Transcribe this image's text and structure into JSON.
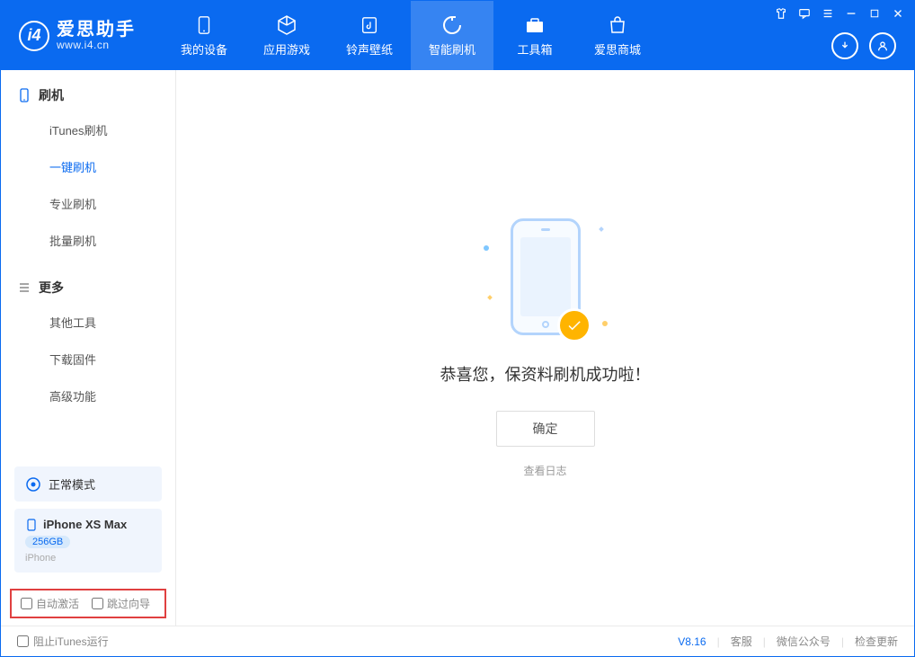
{
  "app": {
    "title": "爱思助手",
    "subtitle": "www.i4.cn"
  },
  "nav": {
    "my_device": "我的设备",
    "apps_games": "应用游戏",
    "ring_wall": "铃声壁纸",
    "smart_flash": "智能刷机",
    "toolbox": "工具箱",
    "store": "爱思商城"
  },
  "sidebar": {
    "section_flash": "刷机",
    "section_more": "更多",
    "items": {
      "itunes_flash": "iTunes刷机",
      "oneclick_flash": "一键刷机",
      "pro_flash": "专业刷机",
      "batch_flash": "批量刷机",
      "other_tools": "其他工具",
      "download_fw": "下载固件",
      "advanced": "高级功能"
    }
  },
  "device": {
    "mode": "正常模式",
    "name": "iPhone XS Max",
    "storage": "256GB",
    "type": "iPhone"
  },
  "bottom_checks": {
    "auto_activate": "自动激活",
    "skip_guide": "跳过向导"
  },
  "main": {
    "success_text": "恭喜您，保资料刷机成功啦！",
    "ok_button": "确定",
    "view_log": "查看日志"
  },
  "footer": {
    "block_itunes": "阻止iTunes运行",
    "version": "V8.16",
    "support": "客服",
    "wechat": "微信公众号",
    "check_update": "检查更新"
  }
}
